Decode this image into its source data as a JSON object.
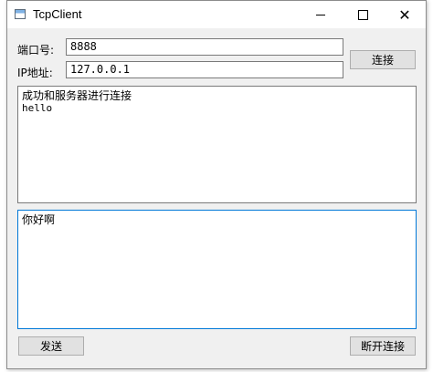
{
  "window": {
    "title": "TcpClient"
  },
  "form": {
    "port_label": "端口号:",
    "port_value": "8888",
    "ip_label": "IP地址:",
    "ip_value": "127.0.0.1",
    "connect_label": "连接"
  },
  "receive": {
    "lines": [
      "成功和服务器进行连接",
      "hello"
    ]
  },
  "send": {
    "text": "你好啊",
    "send_label": "发送",
    "disconnect_label": "断开连接"
  },
  "colors": {
    "focus_border": "#0078d7",
    "button_bg": "#e1e1e1",
    "window_bg": "#f0f0f0"
  },
  "icons": {
    "app": "app-window-icon",
    "minimize": "minimize-icon",
    "maximize": "maximize-icon",
    "close": "close-icon"
  }
}
